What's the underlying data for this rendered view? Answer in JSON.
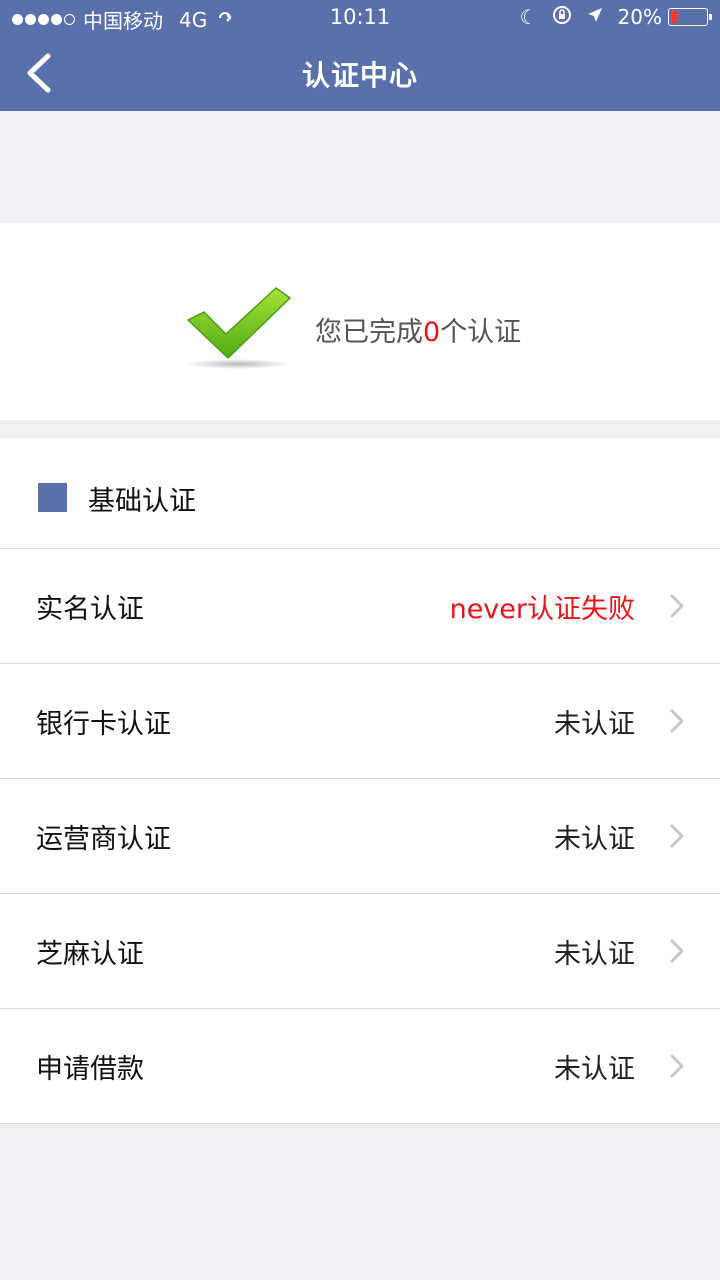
{
  "status_bar": {
    "carrier": "中国移动",
    "network": "4G",
    "time": "10:11",
    "battery": "20%",
    "battery_level": 0.2
  },
  "nav": {
    "title": "认证中心",
    "back_icon": "chevron-left-icon"
  },
  "summary": {
    "prefix": "您已完成",
    "count": "0",
    "suffix": "个认证",
    "icon": "checkmark-icon"
  },
  "section": {
    "title": "基础认证"
  },
  "rows": [
    {
      "label": "实名认证",
      "status": "never认证失败",
      "failed": true
    },
    {
      "label": "银行卡认证",
      "status": "未认证",
      "failed": false
    },
    {
      "label": "运营商认证",
      "status": "未认证",
      "failed": false
    },
    {
      "label": "芝麻认证",
      "status": "未认证",
      "failed": false
    },
    {
      "label": "申请借款",
      "status": "未认证",
      "failed": false
    }
  ],
  "colors": {
    "header": "#5a70ab",
    "fail": "#e5141b",
    "check_green": "#6ec81e"
  }
}
